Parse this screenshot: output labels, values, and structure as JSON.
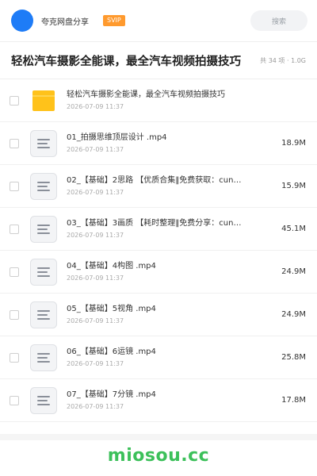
{
  "header": {
    "share_name": "夸克网盘分享",
    "vip_label": "SVIP",
    "search_placeholder": "搜索",
    "accent_color": "#1e7cf7",
    "vip_color": "#ff9a2e"
  },
  "folder": {
    "title": "轻松汽车摄影全能课，最全汽车视频拍摄技巧",
    "meta": "共 34 项 · 1.0G"
  },
  "items": [
    {
      "type": "folder",
      "icon": "folder-icon",
      "name": "轻松汽车摄影全能课，最全汽车视频拍摄技巧",
      "date": "2026-07-09 11:37",
      "size": ""
    },
    {
      "type": "file",
      "icon": "document-icon",
      "name": "01_拍摄思维顶层设计 .mp4",
      "date": "2026-07-09 11:37",
      "size": "18.9M"
    },
    {
      "type": "file",
      "icon": "document-icon",
      "name": "02_【基础】2思路 【优质合集‖免费获取：cun…",
      "date": "2026-07-09 11:37",
      "size": "15.9M"
    },
    {
      "type": "file",
      "icon": "document-icon",
      "name": "03_【基础】3画质 【耗时整理‖免费分享：cun…",
      "date": "2026-07-09 11:37",
      "size": "45.1M"
    },
    {
      "type": "file",
      "icon": "document-icon",
      "name": "04_【基础】4构图 .mp4",
      "date": "2026-07-09 11:37",
      "size": "24.9M"
    },
    {
      "type": "file",
      "icon": "document-icon",
      "name": "05_【基础】5视角 .mp4",
      "date": "2026-07-09 11:37",
      "size": "24.9M"
    },
    {
      "type": "file",
      "icon": "document-icon",
      "name": "06_【基础】6运镜 .mp4",
      "date": "2026-07-09 11:37",
      "size": "25.8M"
    },
    {
      "type": "file",
      "icon": "document-icon",
      "name": "07_【基础】7分镜 .mp4",
      "date": "2026-07-09 11:37",
      "size": "17.8M"
    }
  ],
  "watermark": "miosou.cc"
}
